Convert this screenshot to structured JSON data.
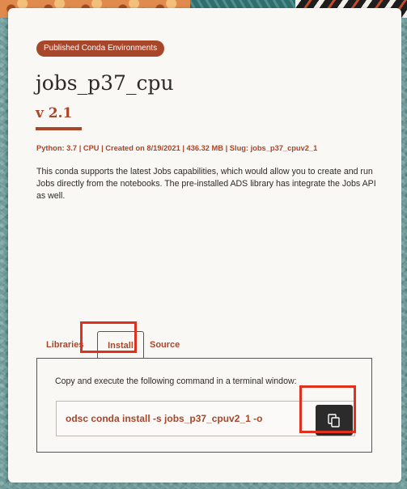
{
  "badge": "Published Conda Environments",
  "title": "jobs_p37_cpu",
  "version": "v 2.1",
  "meta": "Python: 3.7 | CPU | Created on 8/19/2021 | 436.32 MB | Slug: jobs_p37_cpuv2_1",
  "description": "This conda supports the latest Jobs capabilities, which would allow you to create and run Jobs directly from the notebooks. The pre-installed ADS library has integrate the Jobs API as well.",
  "tabs": [
    {
      "label": "Libraries",
      "active": false
    },
    {
      "label": "Install",
      "active": true
    },
    {
      "label": "Source",
      "active": false
    }
  ],
  "install": {
    "instruction": "Copy and execute the following command in a terminal window:",
    "command": "odsc conda install -s jobs_p37_cpuv2_1 -o",
    "copy_icon": "copy-icon"
  },
  "colors": {
    "accent": "#a8462a",
    "highlight": "#e0301e",
    "button_dark": "#2b2b2b",
    "card_bg": "#faf8f5"
  }
}
